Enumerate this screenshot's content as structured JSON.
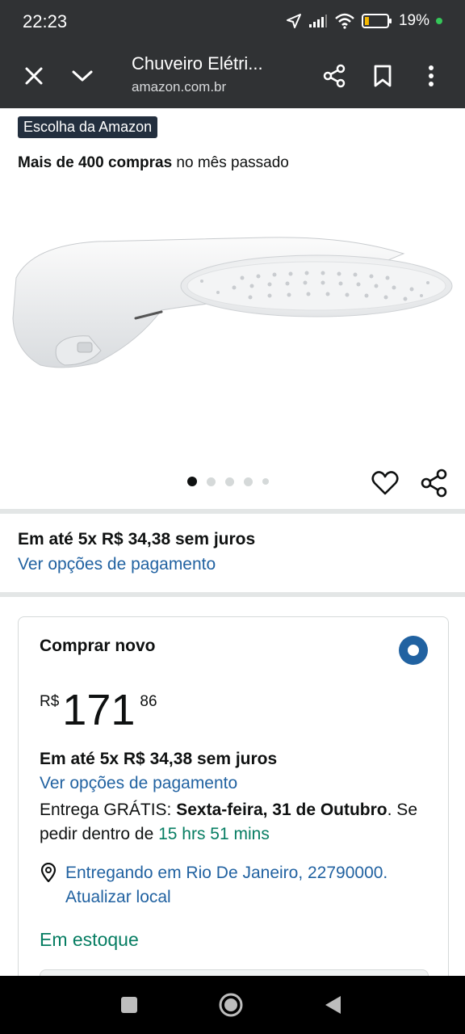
{
  "status_bar": {
    "time": "22:23",
    "battery_text": "19%",
    "battery_level": 0.19,
    "icons": [
      "location-arrow-icon",
      "signal-icon",
      "wifi-icon",
      "battery-icon"
    ]
  },
  "browser": {
    "title": "Chuveiro Elétri...",
    "domain": "amazon.com.br",
    "icons": [
      "close-icon",
      "chevron-down-icon",
      "share-icon",
      "bookmark-icon",
      "more-vert-icon"
    ]
  },
  "product": {
    "badge": "Escolha da Amazon",
    "purchases_bold": "Mais de 400 compras",
    "purchases_rest": " no mês passado",
    "image_count": 5,
    "active_image": 1
  },
  "payment": {
    "installments": "Em até 5x R$ 34,38 sem juros",
    "options_link": "Ver opções de pagamento"
  },
  "buy_box": {
    "title": "Comprar novo",
    "currency": "R$",
    "price_whole": "171",
    "price_fraction": "86",
    "installments": "Em até 5x R$ 34,38 sem juros",
    "options_link": "Ver opções de pagamento",
    "delivery_prefix": "Entrega GRÁTIS: ",
    "delivery_date": "Sexta-feira, 31 de Outubro",
    "delivery_mid": ". Se pedir dentro de ",
    "delivery_countdown": "15 hrs 51 mins",
    "location": "Entregando em Rio De Janeiro, 22790000. Atualizar local",
    "stock": "Em estoque"
  },
  "colors": {
    "link": "#2162a1",
    "green": "#067d62",
    "badge_bg": "#232f3e",
    "chrome_bg": "#303234"
  }
}
